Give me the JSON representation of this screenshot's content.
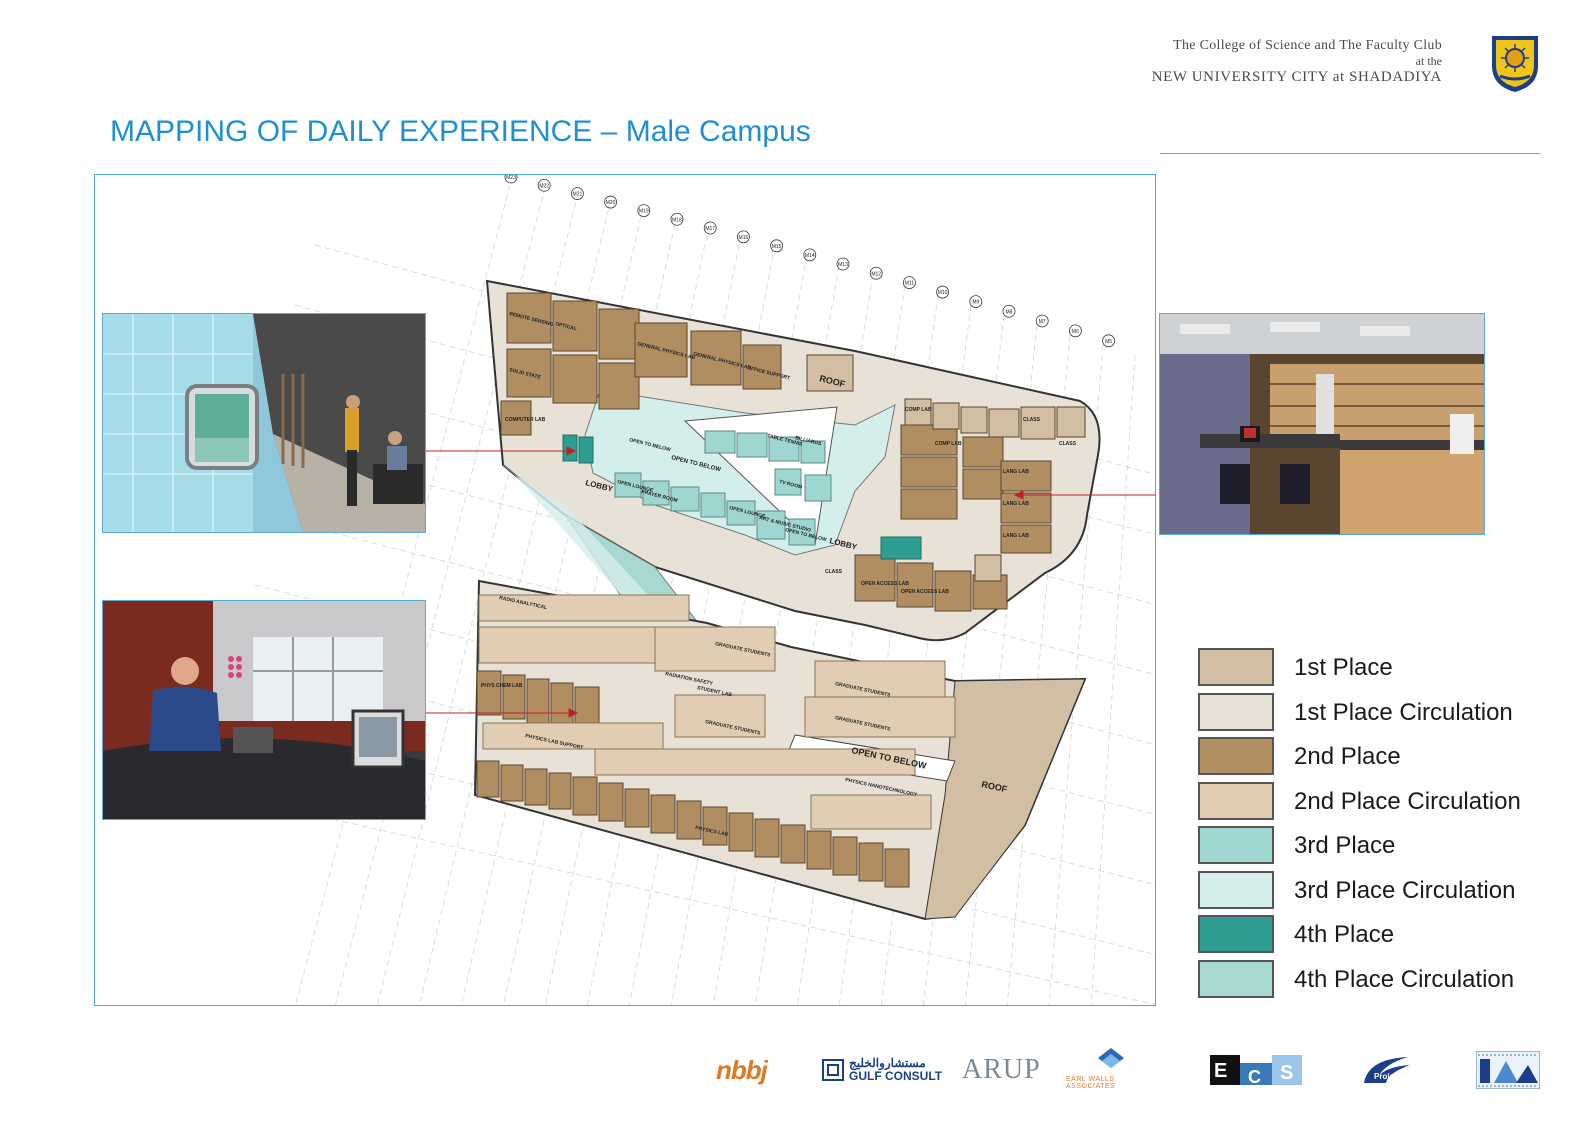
{
  "header": {
    "line1": "The College of Science and The Faculty Club",
    "line2": "at the",
    "line3": "NEW UNIVERSITY CITY at SHADADIYA"
  },
  "title": "MAPPING OF DAILY EXPERIENCE – Male Campus",
  "colors": {
    "title_blue": "#1e8fd4",
    "first_place": "#d2bea2",
    "first_place_circulation": "#e8e1d6",
    "second_place": "#b08e62",
    "second_place_circulation": "#e0cdb3",
    "third_place": "#9fd6d2",
    "third_place_circulation": "#d4eeec",
    "fourth_place": "#2f9e92",
    "fourth_place_circulation": "#a8d8d2"
  },
  "legend": [
    {
      "label": "1st Place",
      "color": "#d2bea2"
    },
    {
      "label": "1st Place Circulation",
      "color": "#e8e1d6"
    },
    {
      "label": "2nd Place",
      "color": "#b08e62"
    },
    {
      "label": "2nd Place Circulation",
      "color": "#e0cdb3"
    },
    {
      "label": "3rd Place",
      "color": "#9fd6d2"
    },
    {
      "label": "3rd Place Circulation",
      "color": "#d4eeec"
    },
    {
      "label": "4th Place",
      "color": "#2f9e92"
    },
    {
      "label": "4th Place Circulation",
      "color": "#a8d8d2"
    }
  ],
  "grid_markers": [
    "M23",
    "M22",
    "M21",
    "M20",
    "M19",
    "M18",
    "M17",
    "M16",
    "M15",
    "M14",
    "M13",
    "M12",
    "M11",
    "M10",
    "M9",
    "M8",
    "M7",
    "M6",
    "M5"
  ],
  "plan_labels": {
    "roof_upper": "ROOF",
    "roof_lower": "ROOF",
    "lobby_left": "LOBBY",
    "lobby_right": "LOBBY",
    "open_to_below_1": "OPEN TO BELOW",
    "open_to_below_2": "OPEN TO BELOW",
    "open_to_below_3": "OPEN TO BELOW",
    "open_to_below_big": "OPEN TO BELOW",
    "computer_lab": "COMPUTER LAB",
    "office_support": "OFFICE SUPPORT",
    "prayer_room": "PRAYER ROOM",
    "tv_room": "TV ROOM",
    "billiards": "BILLIARDS",
    "table_tennis": "TABLE TENNIS",
    "art_music": "ART & MUSIC STUDIO",
    "open_lounge_1": "OPEN LOUNGE",
    "open_lounge_2": "OPEN LOUNGE",
    "class_1": "CLASS",
    "class_2": "CLASS",
    "class_3": "CLASS",
    "lang_lab_1": "LANG LAB",
    "lang_lab_2": "LANG LAB",
    "lang_lab_3": "LANG LAB",
    "comp_lab_1": "COMP LAB",
    "comp_lab_2": "COMP LAB",
    "open_access_1": "OPEN ACCESS LAB",
    "open_access_2": "OPEN ACCESS LAB",
    "general_physics_1": "GENERAL PHYSICS LAB",
    "general_physics_2": "GENERAL PHYSICS LAB",
    "optical": "OPTICAL",
    "remote_sensing": "REMOTE SENSING",
    "solid_state": "SOLID STATE",
    "graduate_students_1": "GRADUATE STUDENTS",
    "graduate_students_2": "GRADUATE STUDENTS",
    "graduate_students_3": "GRADUATE STUDENTS",
    "graduate_students_4": "GRADUATE STUDENTS",
    "physics_lab_support": "PHYSICS LAB SUPPORT",
    "radiation_safety": "RADIATION SAFETY",
    "student_lab": "STUDENT LAB",
    "physics_lab": "PHYSICS LAB",
    "phys_chem_lab": "PHYS CHEM LAB",
    "physics_nanotechnology": "PHYSICS NANOTECHNOLOGY",
    "radio_analytical": "RADIO ANALYTICAL"
  },
  "logos": {
    "nbbj": "nbbj",
    "gulf_arabic": "مستشاروالخليج",
    "gulf": "GULF CONSULT",
    "arup": "ARUP",
    "earl": "EARL WALLS ASSOCIATES",
    "ecs_e": "E",
    "ecs_c": "C",
    "ecs_s": "S",
    "projacs": "Projacs"
  }
}
